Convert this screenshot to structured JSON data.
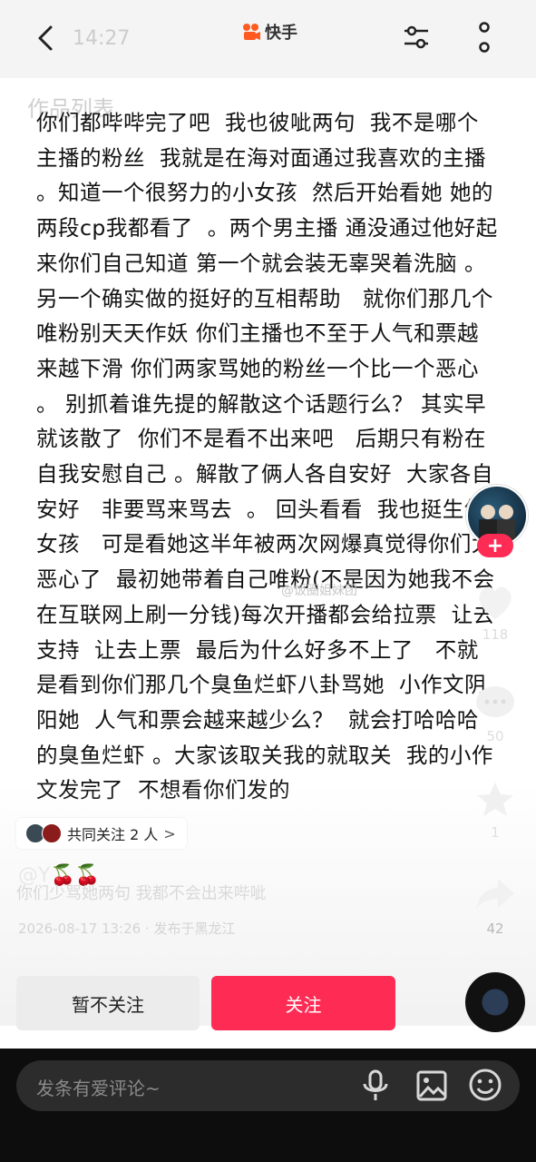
{
  "status": {
    "time": "14:27"
  },
  "app": {
    "name": "快手"
  },
  "ghost_header": "作品列表",
  "post": {
    "text": "你们都哔哔完了吧  我也彼呲两句  我不是哪个主播的粉丝  我就是在海对面通过我喜欢的主播 。知道一个很努力的小女孩  然后开始看她 她的两段cp我都看了  。两个男主播 通没通过他好起来你们自己知道 第一个就会装无辜哭着洗脑 。 另一个确实做的挺好的互相帮助   就你们那几个唯粉别天天作妖 你们主播也不至于人气和票越来越下滑 你们两家骂她的粉丝一个比一个恶心   。 别抓着谁先提的解散这个话题行么？ 其实早就该散了  你们不是看不出来吧   后期只有粉在自我安慰自己 。解散了俩人各自安好  大家各自安好   非要骂来骂去  。 回头看看  我也挺生气女孩   可是看她这半年被两次网爆真觉得你们太恶心了  最初她带着自己唯粉(不是因为她我不会在互联网上刷一分钱)每次开播都会给拉票  让去支持  让去上票  最后为什么好多不上了   不就是看到你们那几个臭鱼烂虾八卦骂她  小作文阴阳她  人气和票会越来越少么？  就会打哈哈哈的臭鱼烂虾 。大家该取关我的就取关  我的小作文发完了  不想看你们发的"
  },
  "watermark": "@饭圈姐妹团",
  "side": {
    "like_count": "118",
    "comment_count": "50",
    "fav_count": "1",
    "share_count": "42"
  },
  "mutual": {
    "label": "共同关注 2 人"
  },
  "author": {
    "name": "@Y",
    "emoji": "🍒🍒"
  },
  "caption": "你们少骂她两句 我都不会出来哔呲",
  "meta": "2026-08-17 13:26 · 发布于黑龙江",
  "buttons": {
    "not_follow": "暂不关注",
    "follow": "关注"
  },
  "comment": {
    "placeholder": "发条有爱评论~"
  },
  "colors": {
    "accent": "#fe2c55",
    "logo": "#ff5a1f"
  }
}
